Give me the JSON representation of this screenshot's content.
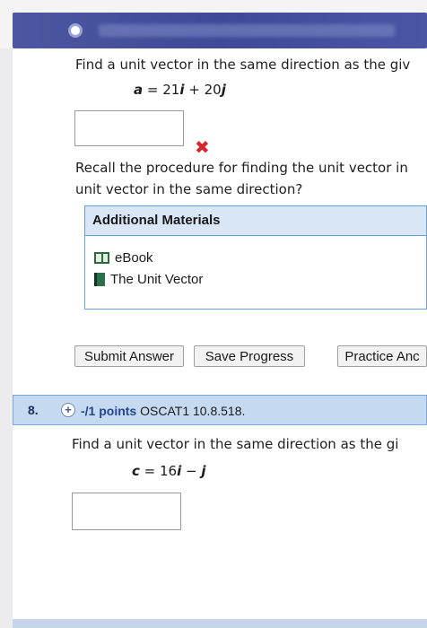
{
  "header": {
    "blurred": true
  },
  "question7": {
    "prompt": "Find a unit vector in the same direction as the giv",
    "equation_var": "a",
    "equation_rest": " = 21",
    "eq_i": "i",
    "eq_plus": " + 20",
    "eq_j": "j",
    "hint_line1": "Recall the procedure for finding the unit vector in",
    "hint_line2": "unit vector in the same direction?",
    "materials": {
      "title": "Additional Materials",
      "items": [
        {
          "label": "eBook",
          "icon": "ebook-icon"
        },
        {
          "label": "The Unit Vector",
          "icon": "document-icon"
        }
      ]
    },
    "buttons": {
      "submit": "Submit Answer",
      "save": "Save Progress",
      "practice": "Practice Anc"
    },
    "result_mark": "✖"
  },
  "question8": {
    "number": "8.",
    "points": "-/1 points",
    "code": "OSCAT1 10.8.518.",
    "prompt": "Find a unit vector in the same direction as the gi",
    "eq_var": "c",
    "eq_rest": " = 16",
    "eq_i": "i",
    "eq_minus": " − ",
    "eq_j": "j"
  }
}
